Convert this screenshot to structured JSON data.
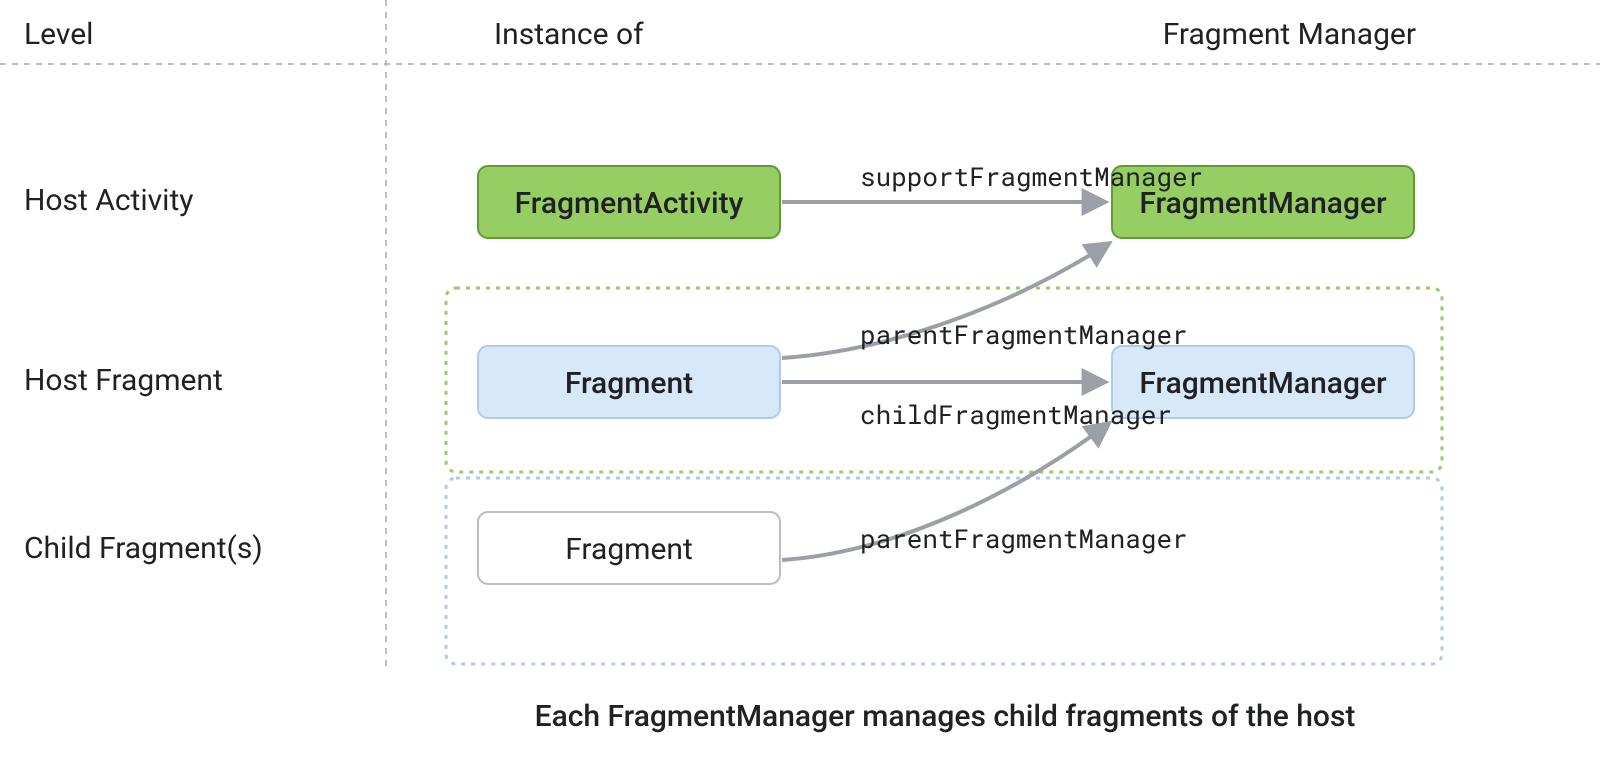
{
  "headers": {
    "level": "Level",
    "instance_of": "Instance of",
    "fragment_manager": "Fragment Manager"
  },
  "levels": {
    "host_activity": "Host Activity",
    "host_fragment": "Host Fragment",
    "child_fragments": "Child Fragment(s)"
  },
  "nodes": {
    "fragment_activity": "FragmentActivity",
    "fragment_manager_top": "FragmentManager",
    "fragment_host": "Fragment",
    "fragment_manager_mid": "FragmentManager",
    "fragment_child": "Fragment"
  },
  "edges": {
    "support_fm": "supportFragmentManager",
    "parent_fm_1": "parentFragmentManager",
    "child_fm": "childFragmentManager",
    "parent_fm_2": "parentFragmentManager"
  },
  "caption": "Each FragmentManager manages child fragments of the host",
  "colors": {
    "green_fill": "#97ce64",
    "green_stroke": "#5f9c34",
    "blue_fill": "#d7e8f9",
    "blue_stroke": "#aecbeb",
    "white_fill": "#ffffff",
    "grey_stroke": "#bdbdbd",
    "dashed": "#bdbdbd",
    "green_dash": "#97ce64",
    "blue_dash": "#aecbeb",
    "arrow": "#9aa0a6"
  }
}
